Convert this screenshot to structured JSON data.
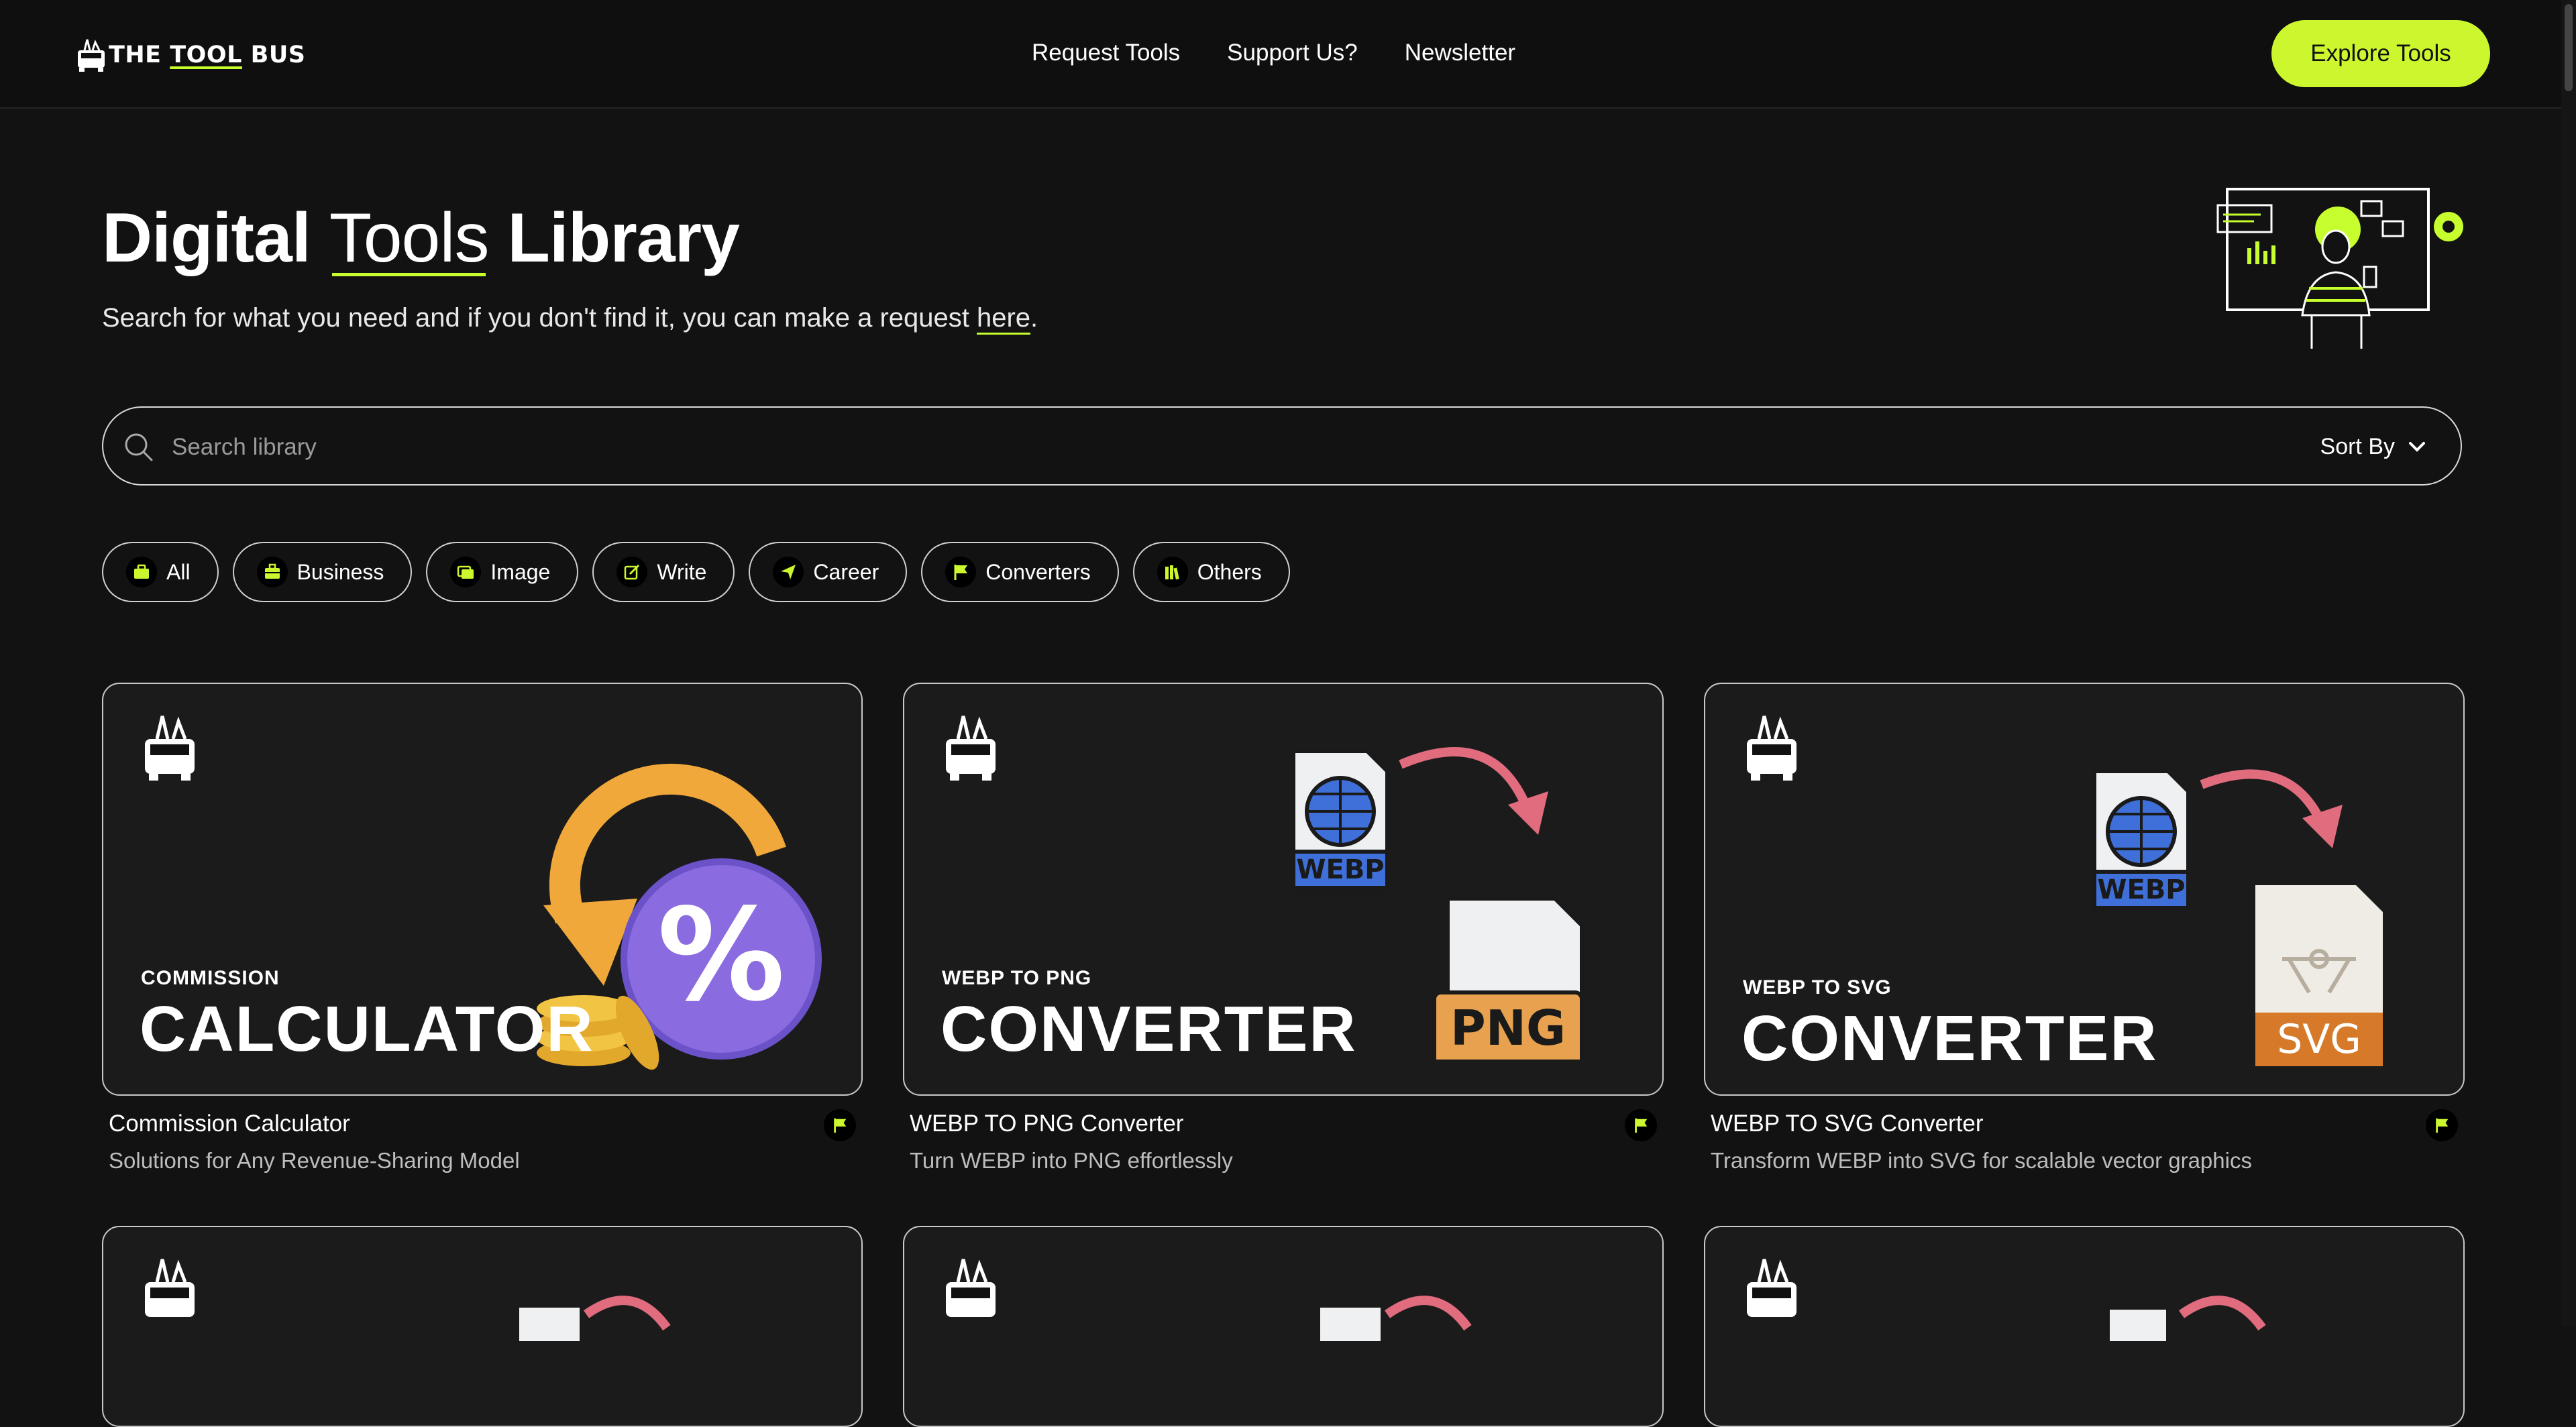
{
  "nav": {
    "logo_text_1": "THE ",
    "logo_text_hl": "TOOL",
    "logo_text_2": " BUS",
    "links": [
      "Request Tools",
      "Support Us?",
      "Newsletter"
    ],
    "cta": "Explore Tools"
  },
  "hero": {
    "title_1": "Digital ",
    "title_2": "Tools",
    "title_3": " Library",
    "subtitle": "Search for what you need and if you don't find it, you can make a request ",
    "subtitle_link": "here",
    "subtitle_end": "."
  },
  "search": {
    "placeholder": "Search library",
    "sort_label": "Sort By",
    "sort_icon": "chevron-down-icon"
  },
  "categories": [
    {
      "label": "All",
      "icon": "toolbox-icon"
    },
    {
      "label": "Business",
      "icon": "briefcase-icon"
    },
    {
      "label": "Image",
      "icon": "image-icon"
    },
    {
      "label": "Write",
      "icon": "edit-icon"
    },
    {
      "label": "Career",
      "icon": "paper-plane-icon"
    },
    {
      "label": "Converters",
      "icon": "flag-icon"
    },
    {
      "label": "Others",
      "icon": "books-icon"
    }
  ],
  "cards": [
    {
      "small": "COMMISSION",
      "big": "CALCULATOR",
      "title": "Commission Calculator",
      "desc": "Solutions for Any Revenue-Sharing Model",
      "art_label": "%"
    },
    {
      "small": "WEBP TO PNG",
      "big": "CONVERTER",
      "title": "WEBP TO PNG Converter",
      "desc": "Turn WEBP into PNG effortlessly",
      "art_from": "WEBP",
      "art_to": "PNG"
    },
    {
      "small": "WEBP TO SVG",
      "big": "CONVERTER",
      "title": "WEBP TO SVG Converter",
      "desc": "Transform WEBP into SVG for scalable vector graphics",
      "art_from": "WEBP",
      "art_to": "SVG"
    }
  ],
  "colors": {
    "accent": "#ccf72f",
    "background": "#121212",
    "card": "#1b1b1b"
  }
}
